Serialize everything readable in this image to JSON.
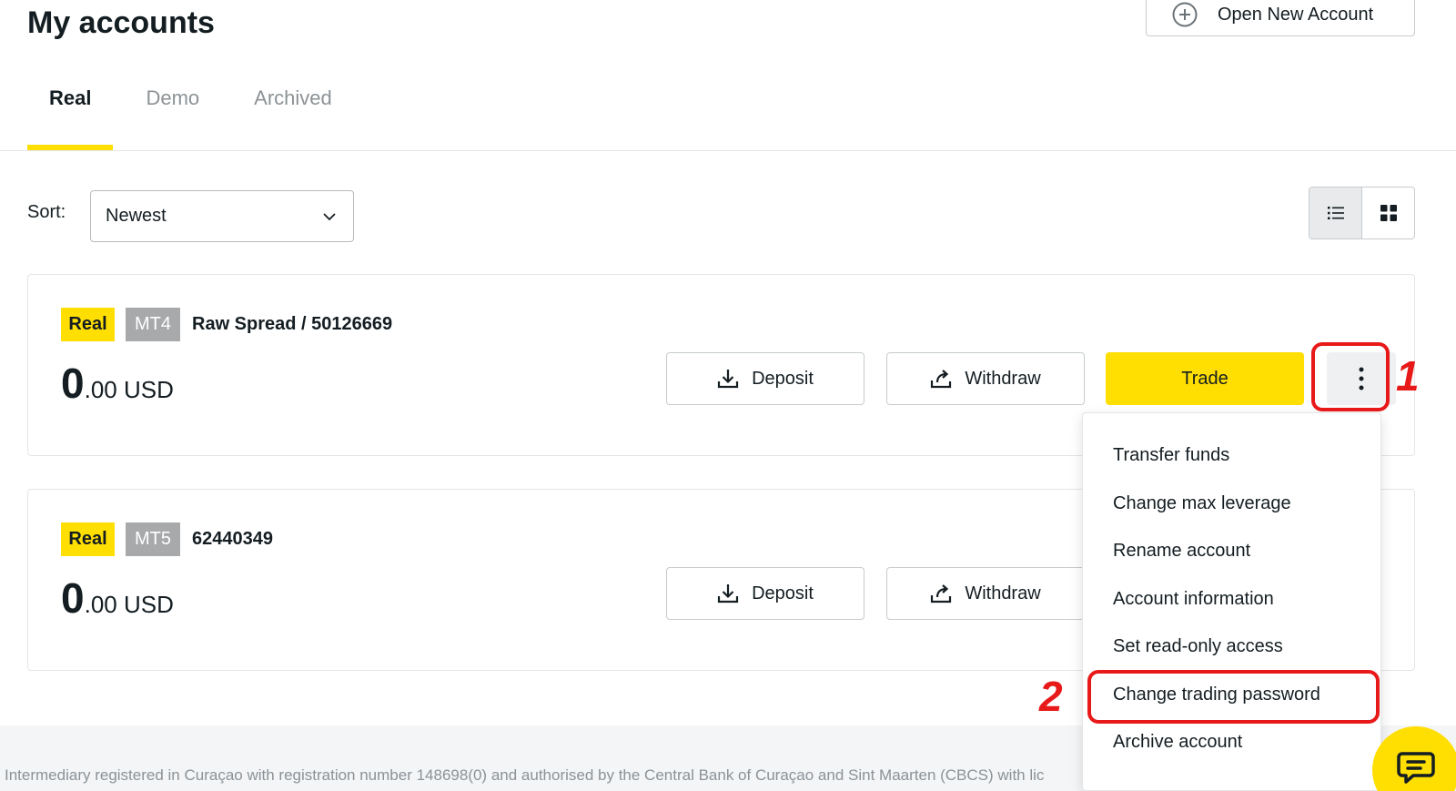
{
  "page": {
    "title": "My accounts"
  },
  "header": {
    "open_account_label": "Open New Account"
  },
  "tabs": [
    {
      "label": "Real",
      "active": true
    },
    {
      "label": "Demo",
      "active": false
    },
    {
      "label": "Archived",
      "active": false
    }
  ],
  "sort": {
    "label": "Sort:",
    "value": "Newest"
  },
  "view_toggle": {
    "selected": "list",
    "options": [
      "list-icon",
      "grid-icon"
    ]
  },
  "accounts": [
    {
      "type_badge": "Real",
      "platform_badge": "MT4",
      "name": "Raw Spread / 50126669",
      "balance_int": "0",
      "balance_rest": ".00 USD",
      "deposit_label": "Deposit",
      "withdraw_label": "Withdraw",
      "trade_label": "Trade"
    },
    {
      "type_badge": "Real",
      "platform_badge": "MT5",
      "name": "62440349",
      "balance_int": "0",
      "balance_rest": ".00 USD",
      "deposit_label": "Deposit",
      "withdraw_label": "Withdraw"
    }
  ],
  "dropdown_menu": {
    "items": [
      "Transfer funds",
      "Change max leverage",
      "Rename account",
      "Account information",
      "Set read-only access",
      "Change trading password",
      "Archive account"
    ]
  },
  "annotations": {
    "step_1": "1",
    "step_2": "2"
  },
  "footer": {
    "text": "Intermediary registered in Curaçao with registration number 148698(0) and authorised by the Central Bank of Curaçao and Sint Maarten (CBCS) with lic"
  },
  "colors": {
    "brand_yellow": "#ffde02",
    "annotation_red": "#e81919",
    "text_dark": "#141d22",
    "text_muted": "#8c9296"
  }
}
